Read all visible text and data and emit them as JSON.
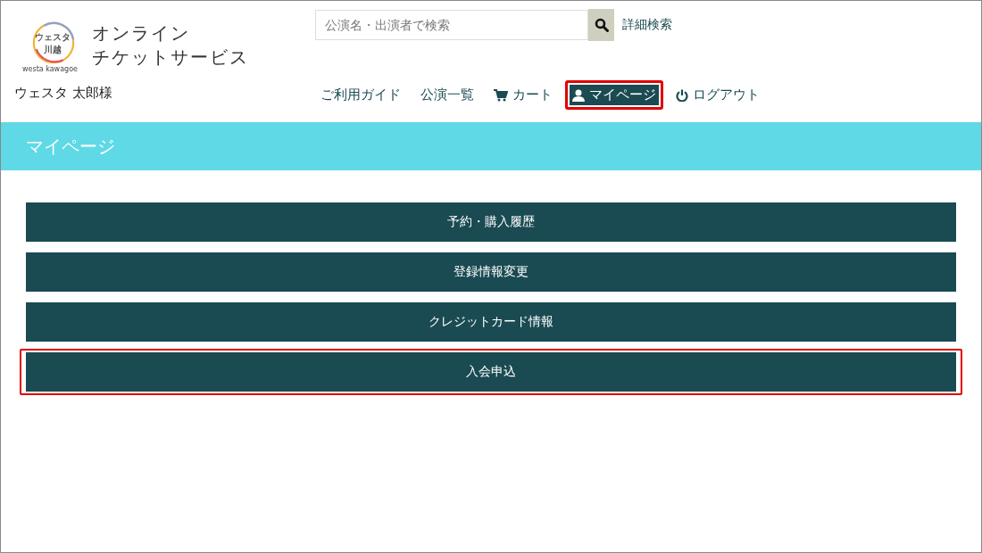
{
  "logo": {
    "mark_line_1": "ウェスタ",
    "mark_line_2": "川越",
    "mark_caption": "westa kawagoe",
    "title_line_1": "オンライン",
    "title_line_2": "チケットサービス"
  },
  "user": {
    "name": "ウェスタ 太郎様"
  },
  "search": {
    "placeholder": "公演名・出演者で検索",
    "advanced_link": "詳細検索"
  },
  "nav": [
    {
      "label": "ご利用ガイド",
      "kind": "plain",
      "selected": false,
      "highlighted": false
    },
    {
      "label": "公演一覧",
      "kind": "plain",
      "selected": false,
      "highlighted": false
    },
    {
      "label": "カート",
      "kind": "cart",
      "selected": false,
      "highlighted": false
    },
    {
      "label": "マイページ",
      "kind": "user",
      "selected": true,
      "highlighted": true
    },
    {
      "label": "ログアウト",
      "kind": "power",
      "selected": false,
      "highlighted": false
    }
  ],
  "page_title": "マイページ",
  "menu": [
    {
      "label": "予約・購入履歴",
      "highlighted": false
    },
    {
      "label": "登録情報変更",
      "highlighted": false
    },
    {
      "label": "クレジットカード情報",
      "highlighted": false
    },
    {
      "label": "入会申込",
      "highlighted": true
    }
  ]
}
